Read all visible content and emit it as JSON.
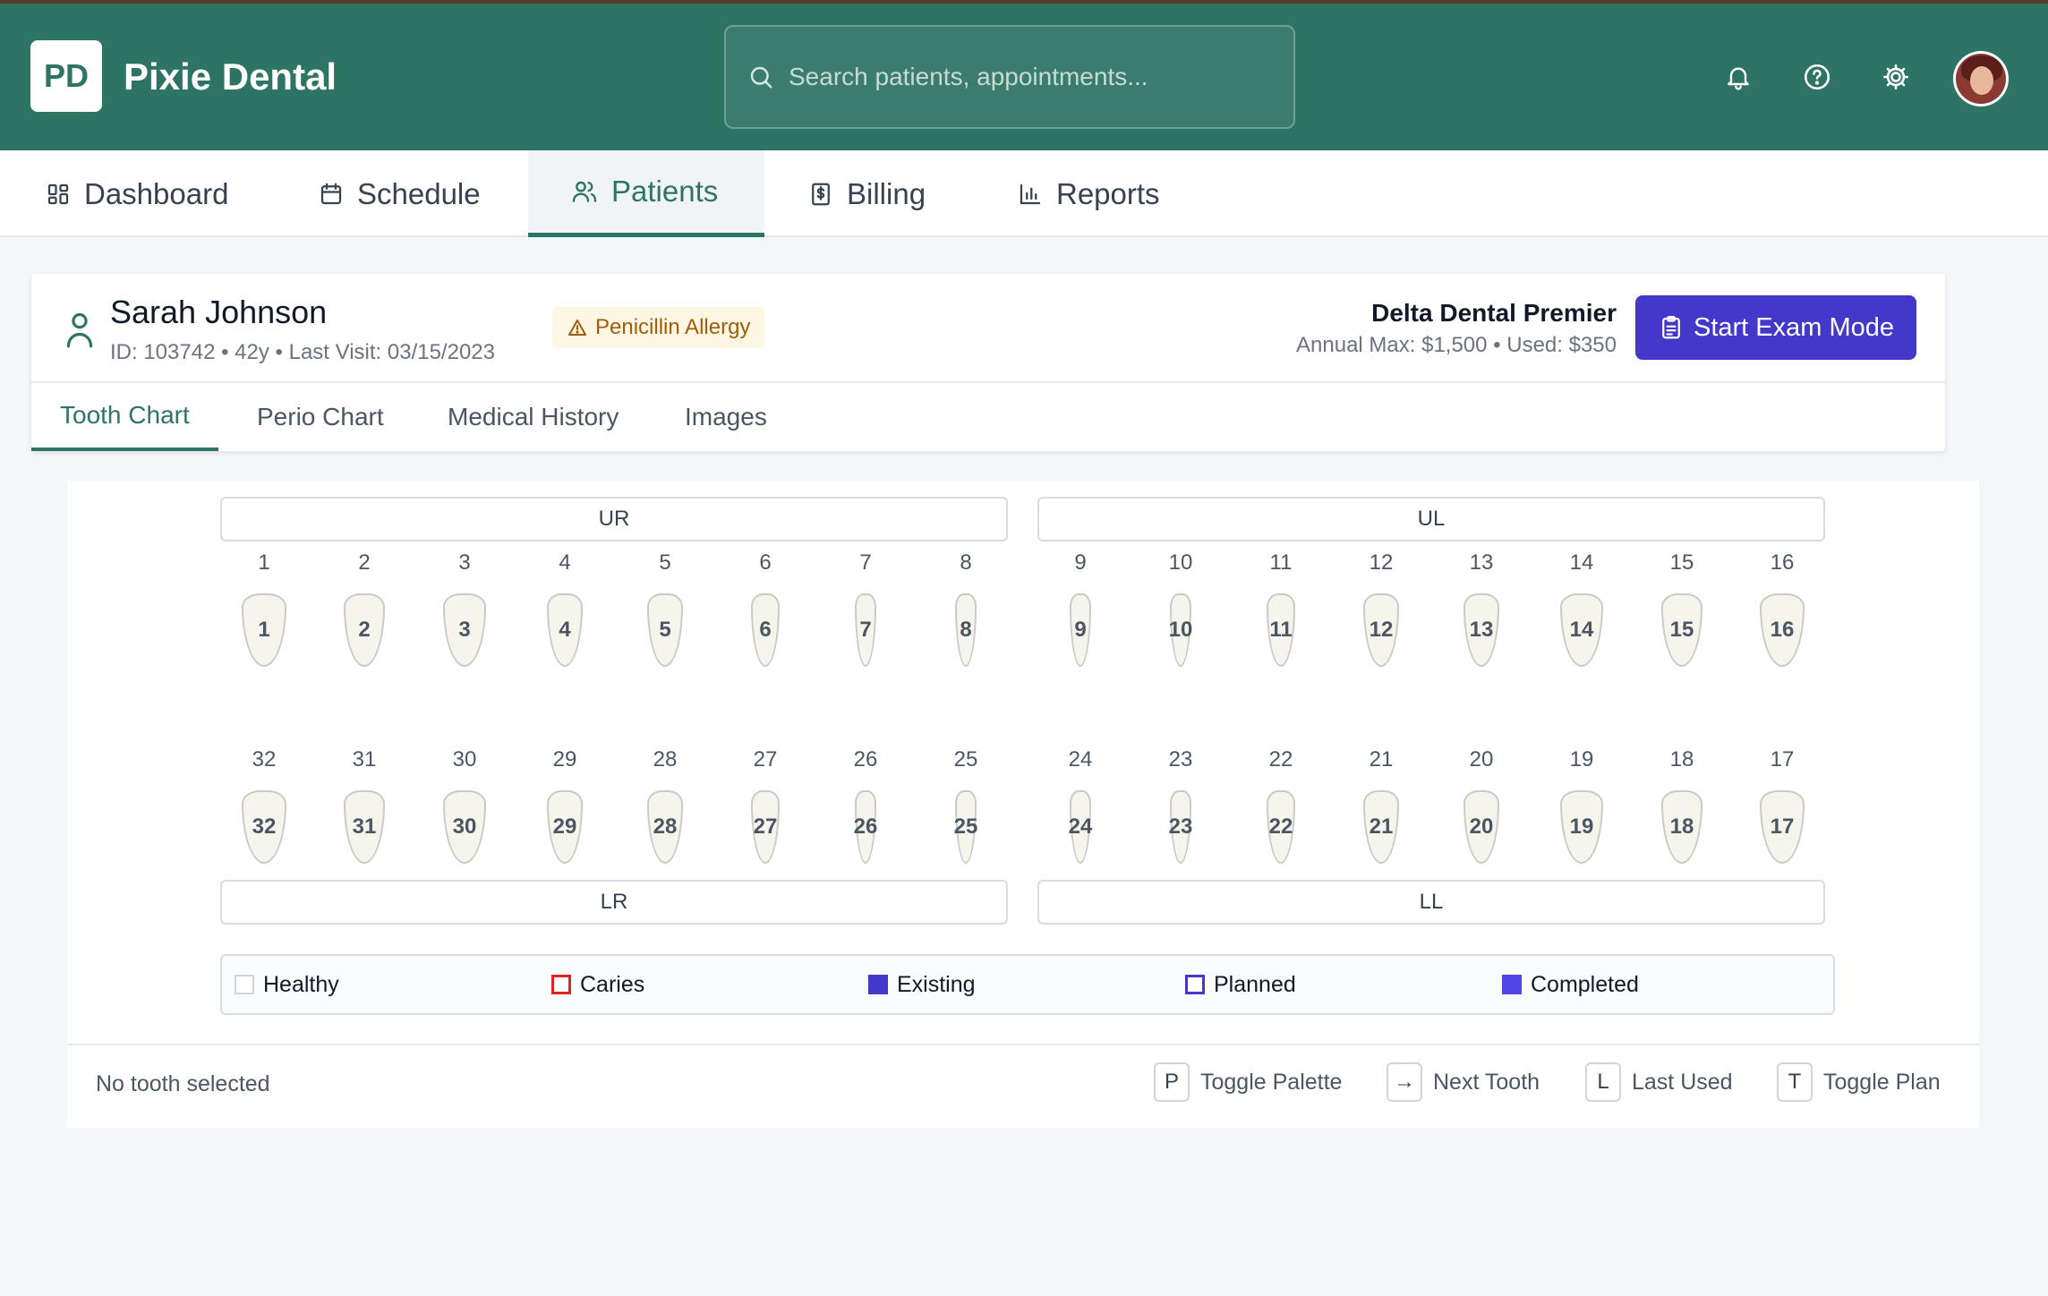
{
  "app": {
    "logo_text": "PD",
    "name": "Pixie Dental",
    "search_placeholder": "Search patients, appointments..."
  },
  "nav": {
    "items": [
      {
        "label": "Dashboard",
        "icon": "grid-icon"
      },
      {
        "label": "Schedule",
        "icon": "calendar-icon"
      },
      {
        "label": "Patients",
        "icon": "users-icon",
        "active": true
      },
      {
        "label": "Billing",
        "icon": "receipt-dollar-icon"
      },
      {
        "label": "Reports",
        "icon": "bar-chart-icon"
      }
    ]
  },
  "patient": {
    "name": "Sarah Johnson",
    "meta": "ID: 103742 • 42y • Last Visit: 03/15/2023",
    "allergy": "Penicillin Allergy",
    "insurance_name": "Delta Dental Premier",
    "insurance_meta": "Annual Max: $1,500 • Used: $350",
    "exam_button": "Start Exam Mode"
  },
  "tabs": [
    "Tooth Chart",
    "Perio Chart",
    "Medical History",
    "Images"
  ],
  "quadrants": {
    "ur": "UR",
    "ul": "UL",
    "lr": "LR",
    "ll": "LL"
  },
  "upper_teeth": [
    "1",
    "2",
    "3",
    "4",
    "5",
    "6",
    "7",
    "8",
    "9",
    "10",
    "11",
    "12",
    "13",
    "14",
    "15",
    "16"
  ],
  "lower_teeth": [
    "32",
    "31",
    "30",
    "29",
    "28",
    "27",
    "26",
    "25",
    "24",
    "23",
    "22",
    "21",
    "20",
    "19",
    "18",
    "17"
  ],
  "legend": [
    {
      "label": "Healthy",
      "color": "#ffffff",
      "border": "#d1d5db",
      "style": "outline"
    },
    {
      "label": "Caries",
      "color": "#ffffff",
      "border": "#dc2626",
      "style": "outline"
    },
    {
      "label": "Existing",
      "color": "#4338ca",
      "border": "#4338ca",
      "style": "filled"
    },
    {
      "label": "Planned",
      "color": "#ffffff",
      "border": "#4338ca",
      "style": "outline"
    },
    {
      "label": "Completed",
      "color": "#4f46e5",
      "border": "#4f46e5",
      "style": "filled"
    }
  ],
  "status": "No tooth selected",
  "shortcuts": [
    {
      "key": "P",
      "label": "Toggle Palette"
    },
    {
      "key": "→",
      "label": "Next Tooth"
    },
    {
      "key": "L",
      "label": "Last Used"
    },
    {
      "key": "T",
      "label": "Toggle Plan"
    }
  ],
  "colors": {
    "brand": "#2e7464",
    "accent": "#4338ca",
    "allergy_bg": "#fdf6e3",
    "allergy_text": "#a15c0b"
  }
}
